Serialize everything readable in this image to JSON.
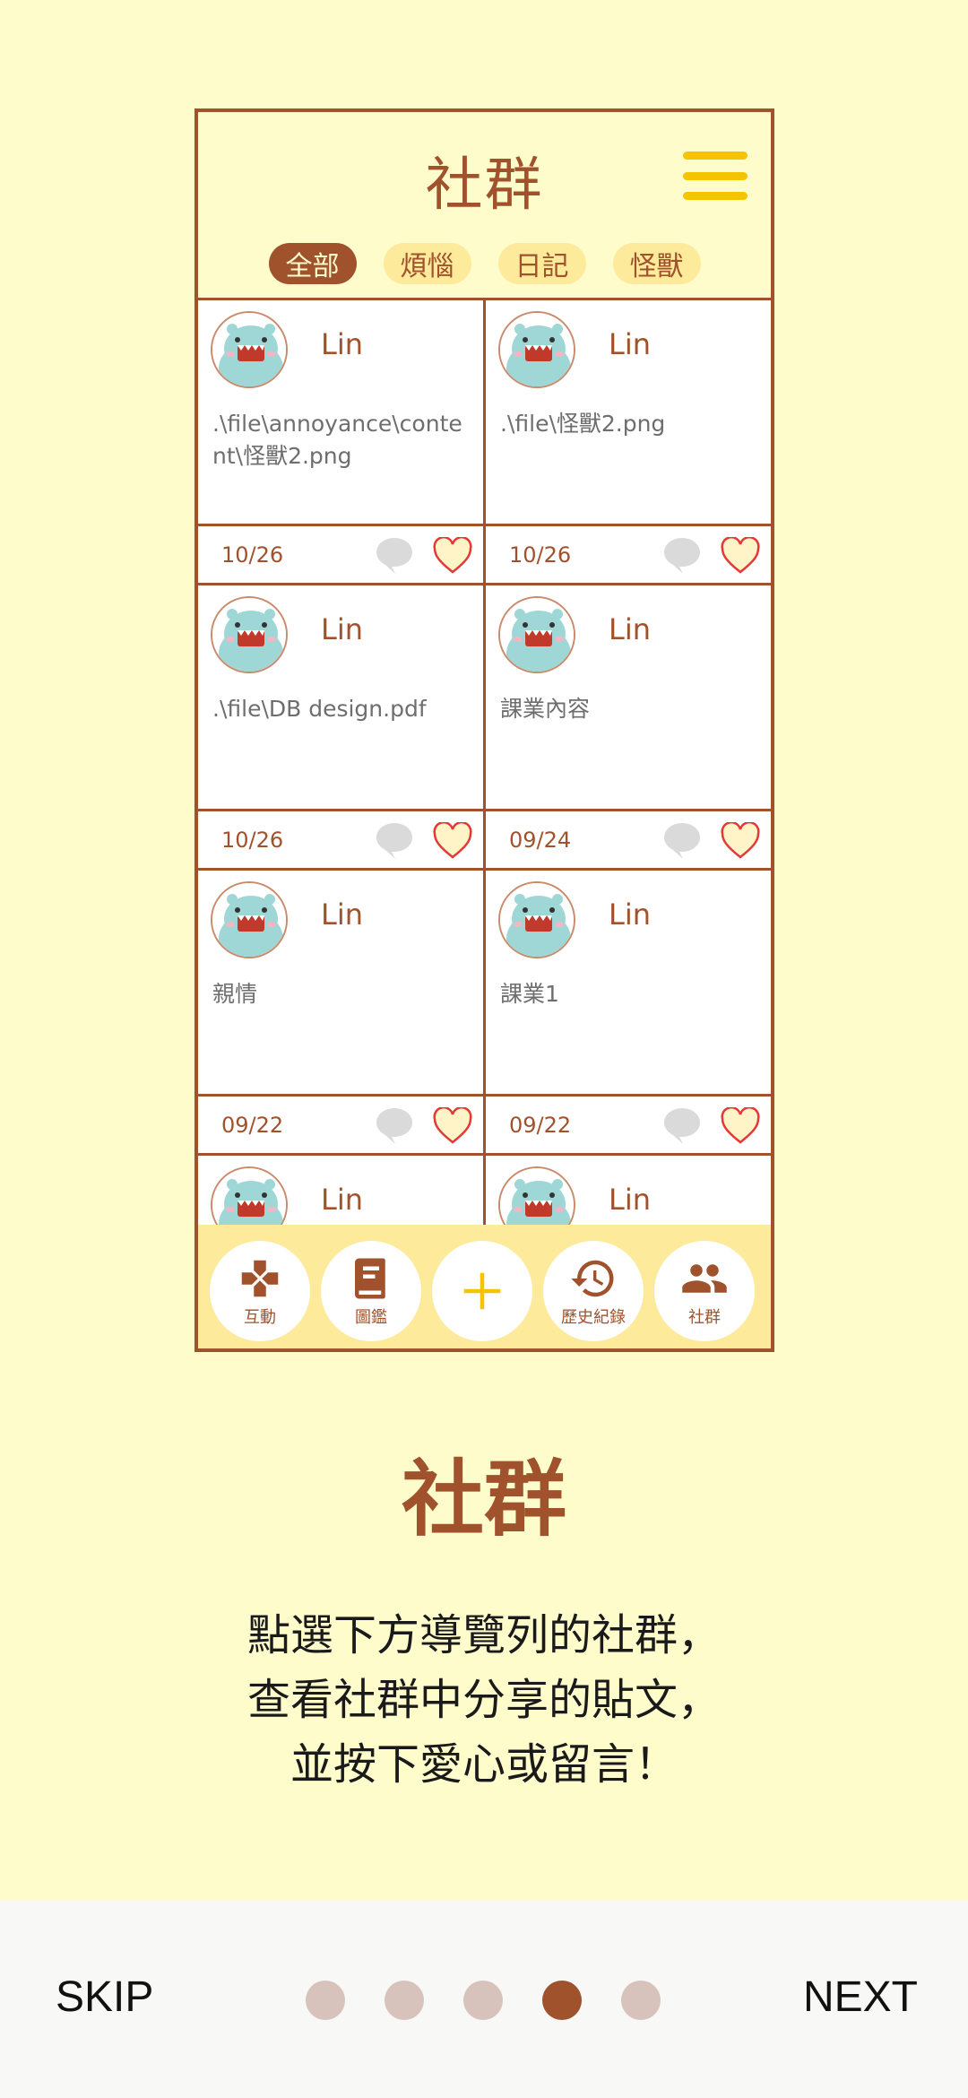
{
  "app": {
    "title": "社群",
    "tabs": [
      {
        "label": "全部",
        "active": true
      },
      {
        "label": "煩惱",
        "active": false
      },
      {
        "label": "日記",
        "active": false
      },
      {
        "label": "怪獸",
        "active": false
      }
    ]
  },
  "posts": [
    {
      "user": "Lin",
      "content": ".\\file\\annoyance\\content\\怪獸2.png",
      "date": "10/26"
    },
    {
      "user": "Lin",
      "content": ".\\file\\怪獸2.png",
      "date": "10/26"
    },
    {
      "user": "Lin",
      "content": ".\\file\\DB design.pdf",
      "date": "10/26"
    },
    {
      "user": "Lin",
      "content": "課業內容",
      "date": "09/24"
    },
    {
      "user": "Lin",
      "content": "親情",
      "date": "09/22"
    },
    {
      "user": "Lin",
      "content": "課業1",
      "date": "09/22"
    },
    {
      "user": "Lin",
      "content": "",
      "date": ""
    },
    {
      "user": "Lin",
      "content": "",
      "date": ""
    }
  ],
  "nav": {
    "items": [
      {
        "label": "互動",
        "icon": "gamepad-icon"
      },
      {
        "label": "圖鑑",
        "icon": "book-icon"
      },
      {
        "label": "",
        "icon": "plus-icon"
      },
      {
        "label": "歷史紀錄",
        "icon": "history-icon"
      },
      {
        "label": "社群",
        "icon": "people-icon"
      }
    ]
  },
  "intro": {
    "title": "社群",
    "lines": [
      "點選下方導覽列的社群，",
      "查看社群中分享的貼文，",
      "並按下愛心或留言！"
    ]
  },
  "footer": {
    "skip": "SKIP",
    "next": "NEXT",
    "page_count": 5,
    "current_page": 4
  },
  "colors": {
    "background": "#FFFCCC",
    "accent": "#A0522D",
    "menu_yellow": "#F5C400",
    "chip_bg": "#FDEA9B"
  }
}
